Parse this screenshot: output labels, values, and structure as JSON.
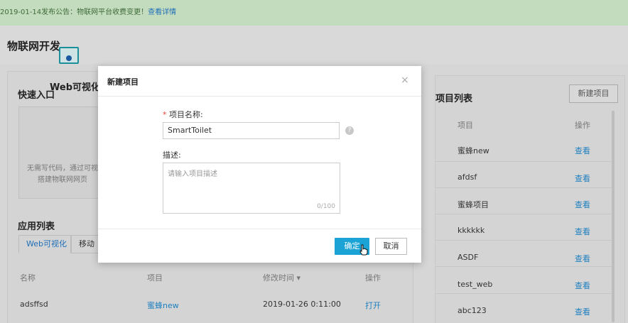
{
  "notice": {
    "text": "2019-01-14发布公告：物联网平台收费变更！",
    "link": "查看详情"
  },
  "page_title": "物联网开发",
  "quick_entry": {
    "title": "快速入口",
    "card_name": "Web可视化开",
    "card_desc_line1": "无需写代码，通过可视",
    "card_desc_line2": "搭建物联网网页"
  },
  "app_list": {
    "title": "应用列表",
    "tabs": [
      "Web可视化",
      "移动"
    ],
    "headers": {
      "name": "名称",
      "project": "项目",
      "modified": "修改时间 ▾",
      "action": "操作"
    },
    "rows": [
      {
        "name": "adsffsd",
        "project": "蜜蜂new",
        "modified": "2019-01-26 0:11:00",
        "action": "打开"
      }
    ]
  },
  "project_list": {
    "title": "项目列表",
    "new_button": "新建项目",
    "headers": {
      "project": "项目",
      "action": "操作"
    },
    "rows": [
      {
        "name": "蜜蜂new",
        "action": "查看"
      },
      {
        "name": "afdsf",
        "action": "查看"
      },
      {
        "name": "蜜蜂项目",
        "action": "查看"
      },
      {
        "name": "kkkkkk",
        "action": "查看"
      },
      {
        "name": "ASDF",
        "action": "查看"
      },
      {
        "name": "test_web",
        "action": "查看"
      },
      {
        "name": "abc123",
        "action": "查看"
      }
    ]
  },
  "modal": {
    "title": "新建项目",
    "close": "×",
    "name_required": "*",
    "name_label": "项目名称:",
    "name_value": "SmartToilet",
    "help": "?",
    "desc_label": "描述:",
    "desc_placeholder": "请输入项目描述",
    "desc_count": "0/100",
    "ok": "确定",
    "cancel": "取消"
  }
}
